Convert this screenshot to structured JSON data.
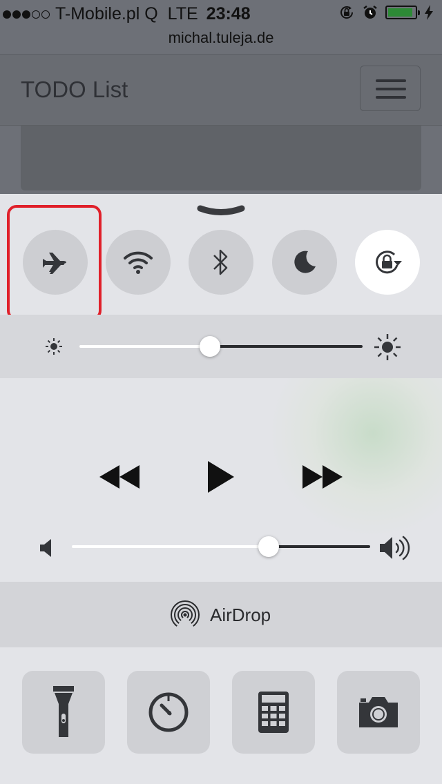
{
  "status_bar": {
    "carrier": "T-Mobile.pl Q",
    "network": "LTE",
    "time": "23:48",
    "signal_bars_filled": 3,
    "signal_bars_total": 5,
    "battery_level": 0.92,
    "icons": [
      "rotation-lock-icon",
      "alarm-icon",
      "battery-icon",
      "charging-bolt-icon"
    ]
  },
  "browser": {
    "url": "michal.tuleja.de"
  },
  "page": {
    "title": "TODO List",
    "menu_icon": "hamburger-menu-icon"
  },
  "control_center": {
    "grabber_icon": "chevron-down-grabber",
    "toggles": [
      {
        "name": "airplane-mode",
        "icon": "airplane-icon",
        "on": false,
        "highlighted": true
      },
      {
        "name": "wifi",
        "icon": "wifi-icon",
        "on": false
      },
      {
        "name": "bluetooth",
        "icon": "bluetooth-icon",
        "on": false
      },
      {
        "name": "do-not-disturb",
        "icon": "moon-icon",
        "on": false
      },
      {
        "name": "rotation-lock",
        "icon": "rotation-lock-icon",
        "on": true
      }
    ],
    "highlight_color": "#e0202a",
    "brightness_level": 0.46,
    "media": {
      "controls": [
        "rewind-icon",
        "play-icon",
        "fast-forward-icon"
      ],
      "volume_level": 0.66
    },
    "airdrop_label": "AirDrop",
    "quick_apps": [
      {
        "name": "flashlight",
        "icon": "flashlight-icon"
      },
      {
        "name": "timer",
        "icon": "timer-icon"
      },
      {
        "name": "calculator",
        "icon": "calculator-icon"
      },
      {
        "name": "camera",
        "icon": "camera-icon"
      }
    ]
  }
}
